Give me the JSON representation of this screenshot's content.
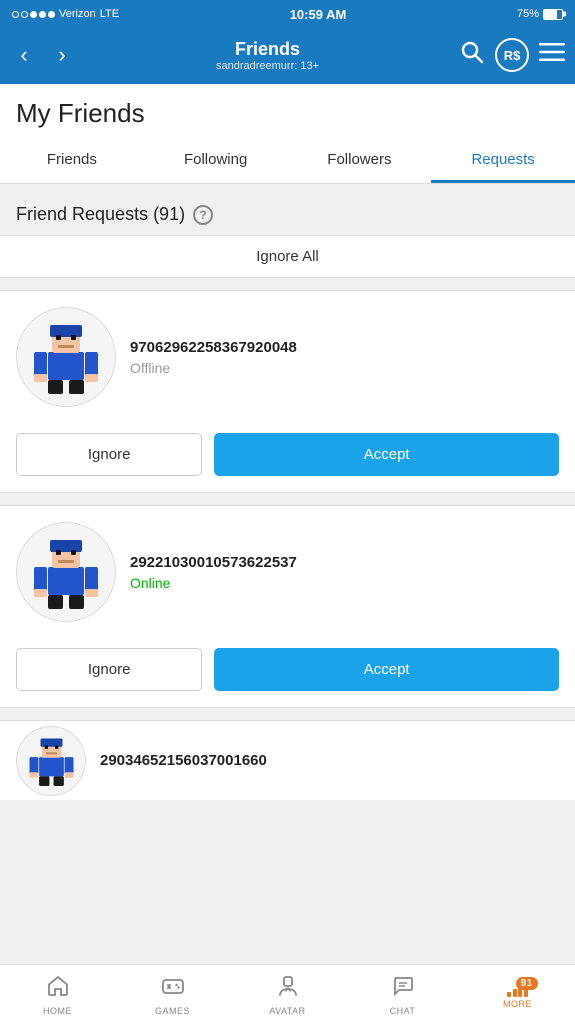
{
  "status_bar": {
    "signal_dots": [
      false,
      false,
      true,
      true,
      true
    ],
    "carrier": "Verizon",
    "network": "LTE",
    "time": "10:59 AM",
    "battery_pct": "75%"
  },
  "header": {
    "title": "Friends",
    "subtitle": "sandradreemurr: 13+",
    "back_label": "‹",
    "forward_label": "›"
  },
  "page": {
    "title": "My Friends"
  },
  "tabs": [
    {
      "id": "friends",
      "label": "Friends",
      "active": false
    },
    {
      "id": "following",
      "label": "Following",
      "active": false
    },
    {
      "id": "followers",
      "label": "Followers",
      "active": false
    },
    {
      "id": "requests",
      "label": "Requests",
      "active": true
    }
  ],
  "requests": {
    "section_title": "Friend Requests (91)",
    "ignore_all_label": "Ignore All",
    "items": [
      {
        "id": "req1",
        "username": "97062962258367920048",
        "status": "Offline",
        "status_type": "offline"
      },
      {
        "id": "req2",
        "username": "29221030010573622537",
        "status": "Online",
        "status_type": "online"
      },
      {
        "id": "req3",
        "username": "29034652156037001660",
        "status": "",
        "status_type": "partial"
      }
    ],
    "ignore_label": "Ignore",
    "accept_label": "Accept"
  },
  "bottom_nav": {
    "items": [
      {
        "id": "home",
        "label": "HOME",
        "icon": "🏠",
        "active": false,
        "badge": null
      },
      {
        "id": "games",
        "label": "GAMES",
        "icon": "🎮",
        "active": false,
        "badge": null
      },
      {
        "id": "avatar",
        "label": "AVATAR",
        "icon": "👤",
        "active": false,
        "badge": null
      },
      {
        "id": "chat",
        "label": "CHAT",
        "icon": "💬",
        "active": false,
        "badge": null
      },
      {
        "id": "more",
        "label": "MORE",
        "icon": "bars",
        "active": true,
        "badge": "91"
      }
    ]
  }
}
